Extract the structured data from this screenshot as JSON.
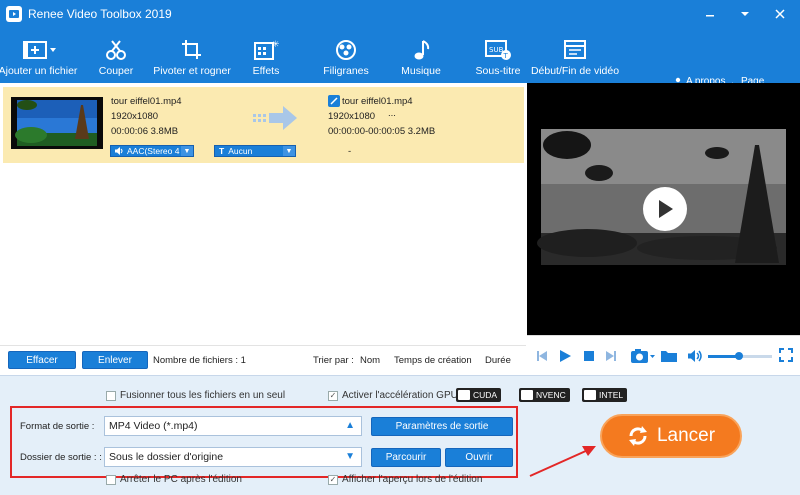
{
  "window": {
    "title": "Renee Video Toolbox 2019"
  },
  "toolbar": {
    "items": [
      {
        "label": "Ajouter un fichier",
        "icon": "add-file-icon"
      },
      {
        "label": "Couper",
        "icon": "cut-icon"
      },
      {
        "label": "Pivoter et rogner",
        "icon": "rotate-crop-icon"
      },
      {
        "label": "Effets",
        "icon": "effects-icon"
      },
      {
        "label": "Filigranes",
        "icon": "watermark-icon"
      },
      {
        "label": "Musique",
        "icon": "music-icon"
      },
      {
        "label": "Sous-titre",
        "icon": "subtitle-icon"
      },
      {
        "label": "Début/Fin de vidéo",
        "icon": "intro-outro-icon"
      }
    ],
    "about": "A propos",
    "home": "Page d'accueil"
  },
  "file": {
    "src_name": "tour eiffel01.mp4",
    "src_res": "1920x1080",
    "src_meta": "00:00:06  3.8MB",
    "out_name": "tour eiffel01.mp4",
    "out_res": "1920x1080",
    "out_dots": "...",
    "out_meta": "00:00:00-00:00:05  3.2MB",
    "audio": "AAC(Stereo 4",
    "subtitle": "Aucun",
    "dash": "-"
  },
  "listbar": {
    "clear": "Effacer",
    "remove": "Enlever",
    "count": "Nombre de fichiers : 1",
    "sort_by": "Trier par :",
    "sort_name": "Nom",
    "sort_time": "Temps de création",
    "sort_duration": "Durée"
  },
  "options": {
    "merge": "Fusionner tous les fichiers en un seul",
    "gpu": "Activer l'accélération GPU",
    "gpu_badges": [
      "CUDA",
      "NVENC",
      "INTEL"
    ],
    "shutdown": "Arrêter le PC après l'édition",
    "preview": "Afficher l'aperçu lors de l'édition"
  },
  "output": {
    "format_label": "Format de sortie :",
    "format_value": "MP4 Video (*.mp4)",
    "params_button": "Paramètres de sortie",
    "folder_label": "Dossier de sortie : :",
    "folder_value": "Sous le dossier d'origine",
    "browse_button": "Parcourir",
    "open_button": "Ouvrir"
  },
  "start_button": "Lancer",
  "colors": {
    "accent": "#1a7fd8",
    "row_highlight": "#fbeab1",
    "start": "#f47a1f",
    "highlight_box": "#e32727"
  }
}
